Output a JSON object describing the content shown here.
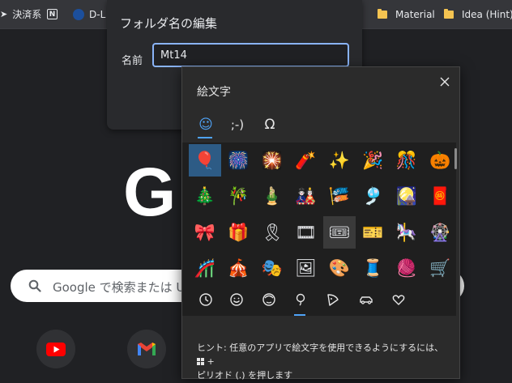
{
  "bookmarks": {
    "item1": "決済系",
    "item2": "",
    "item3": "D-L",
    "material": "Material",
    "idea": "Idea (Hint)"
  },
  "google": {
    "logo_left": "G",
    "logo_right": "",
    "search_placeholder": "Google で検索または U"
  },
  "rename_dialog": {
    "title": "フォルダ名の編集",
    "name_label": "名前",
    "name_value": "Mt14"
  },
  "emoji_panel": {
    "title": "絵文字",
    "tabs": [
      "☺",
      ";-)",
      "Ω"
    ],
    "active_tab": 0,
    "emojis": [
      [
        "🎈",
        "🎆",
        "🎇",
        "🧨",
        "✨",
        "🎉",
        "🎊",
        "🎃"
      ],
      [
        "🎄",
        "🎋",
        "🎍",
        "🎎",
        "🎏",
        "🎐",
        "🎑",
        "🧧"
      ],
      [
        "🎀",
        "🎁",
        "🎗",
        "🎞",
        "🎟",
        "🎫",
        "🎠",
        "🎡"
      ],
      [
        "🎢",
        "🎪",
        "🎭",
        "🖼",
        "🎨",
        "🧵",
        "🧶",
        "🛒"
      ],
      [
        "👓",
        "🕶",
        "🦺",
        "🥽",
        "🥼",
        "🦺",
        "👔",
        "👕"
      ]
    ],
    "selected_emoji": "🎈",
    "categories": [
      "clock-icon",
      "smiley-icon",
      "person-icon",
      "activity-icon",
      "pizza-icon",
      "car-icon",
      "heart-icon"
    ],
    "active_category": 3,
    "hint": "ヒント: 任意のアプリで絵文字を使用できるようにするには、",
    "hint_key": "+",
    "hint2": "ピリオド (.) を押します"
  },
  "colors": {
    "accent": "#8ab4f8",
    "emoji_accent": "#4fa3f7",
    "selected_bg": "#2d5b85"
  }
}
